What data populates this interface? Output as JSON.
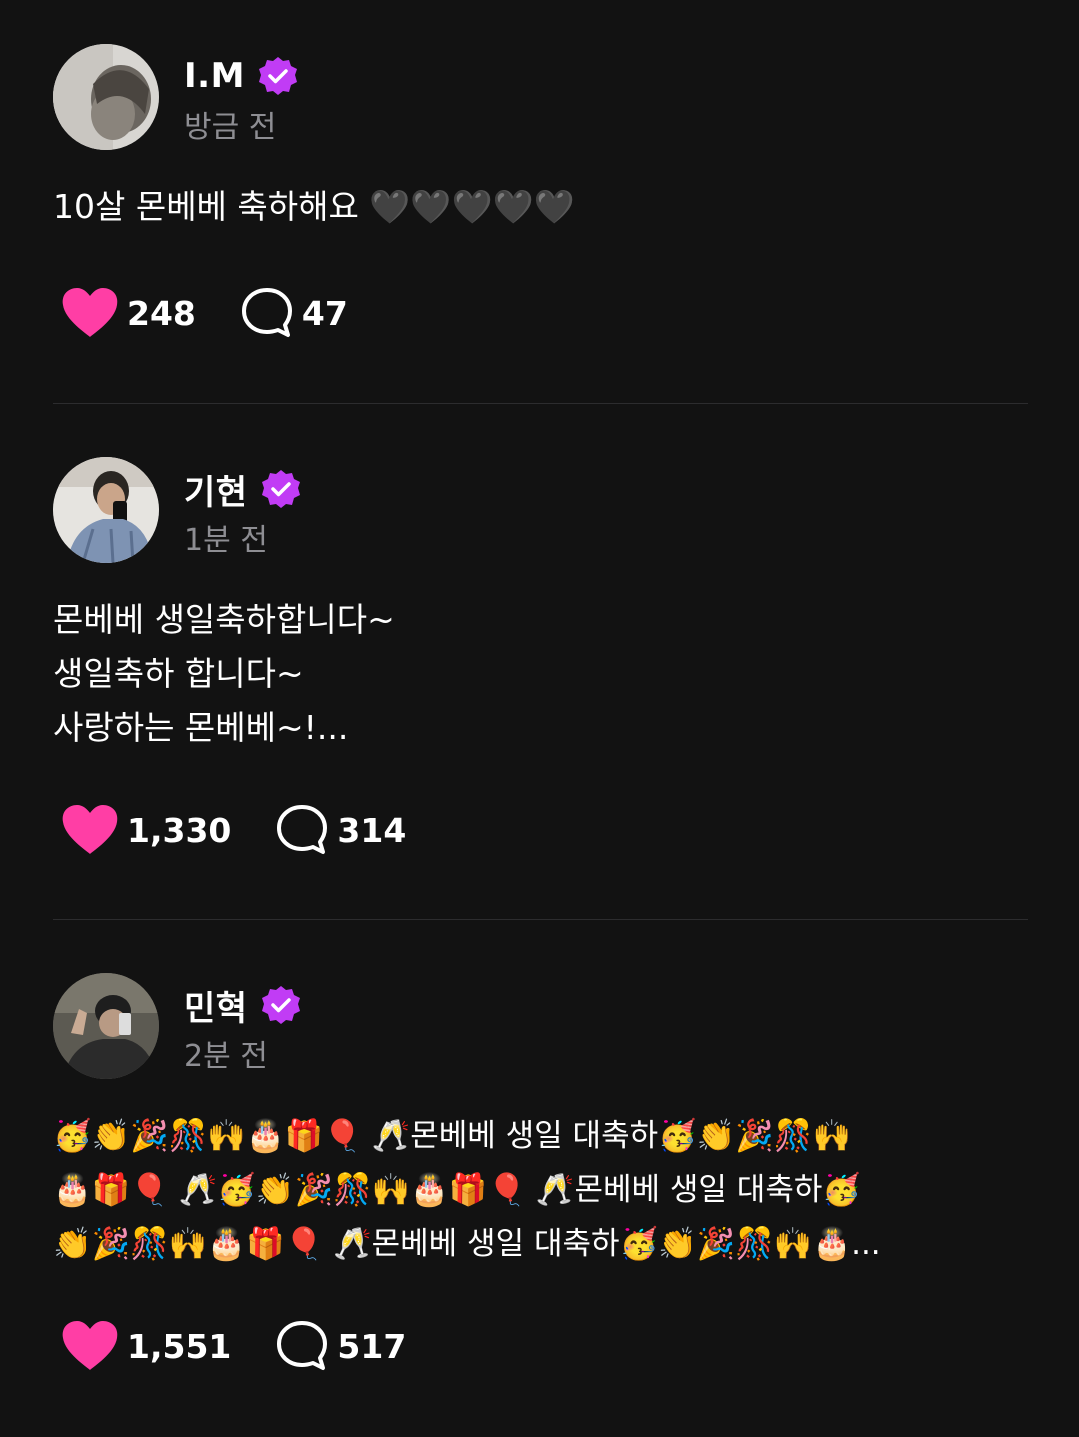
{
  "colors": {
    "background": "#121212",
    "like_heart": "#ff3ea5",
    "verified_badge": "#c13cf5",
    "secondary_text": "#8e8e93",
    "divider": "#2c2c2e"
  },
  "posts": [
    {
      "author": "I.M",
      "time": "방금 전",
      "lines": [
        "10살 몬베베 축하해요 🖤🖤🖤🖤🖤"
      ],
      "likes": "248",
      "comments": "47"
    },
    {
      "author": "기현",
      "time": "1분 전",
      "lines": [
        "몬베베 생일축하합니다~",
        "생일축하 합니다~",
        "사랑하는 몬베베~!..."
      ],
      "likes": "1,330",
      "comments": "314"
    },
    {
      "author": "민혁",
      "time": "2분 전",
      "lines": [
        "🥳👏🎉🎊🙌🎂🎁🎈 🥂몬베베 생일 대축하🥳👏🎉🎊🙌",
        "🎂🎁🎈 🥂🥳👏🎉🎊🙌🎂🎁🎈 🥂몬베베 생일 대축하🥳",
        "👏🎉🎊🙌🎂🎁🎈 🥂몬베베 생일 대축하🥳👏🎉🎊🙌🎂..."
      ],
      "likes": "1,551",
      "comments": "517"
    }
  ]
}
